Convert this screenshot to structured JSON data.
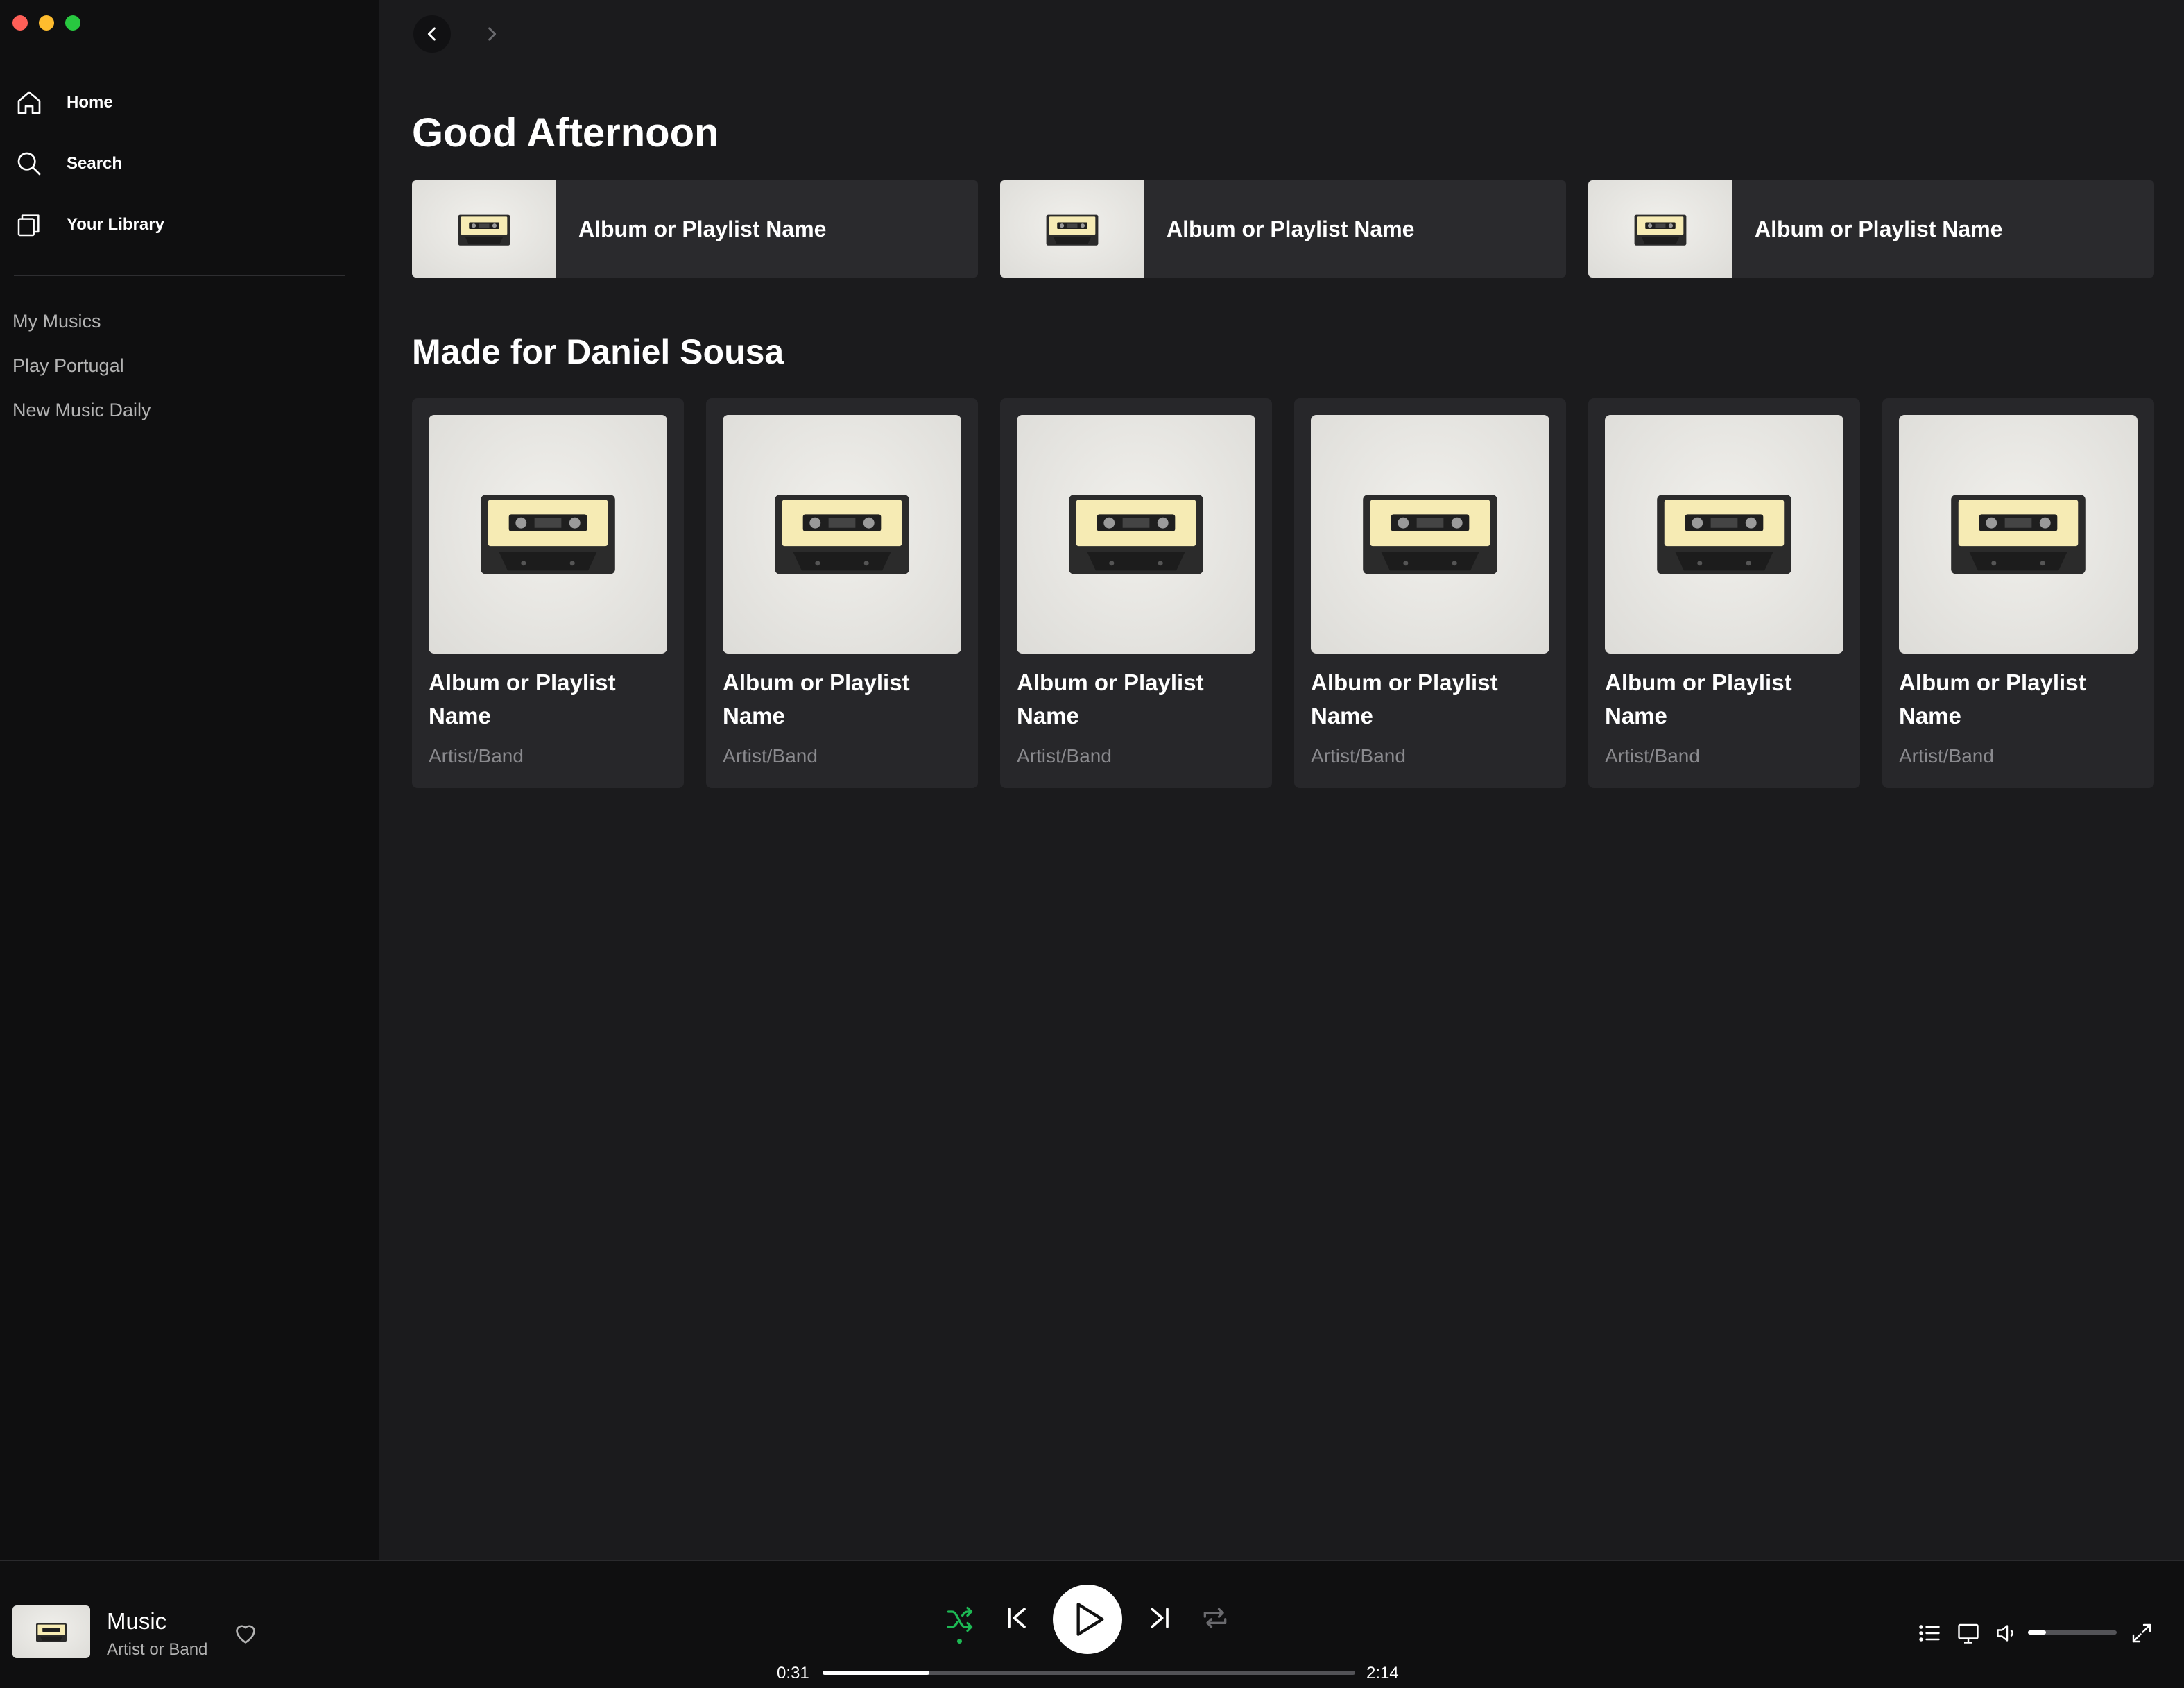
{
  "window": {
    "controls": [
      "close",
      "minimize",
      "zoom"
    ]
  },
  "sidebar": {
    "nav": [
      {
        "label": "Home",
        "icon": "home-icon"
      },
      {
        "label": "Search",
        "icon": "search-icon"
      },
      {
        "label": "Your Library",
        "icon": "library-icon"
      }
    ],
    "playlists": [
      "My Musics",
      "Play Portugal",
      "New Music Daily"
    ]
  },
  "main": {
    "greeting": "Good Afternoon",
    "quick_picks": [
      {
        "name": "Album or Playlist Name"
      },
      {
        "name": "Album or Playlist Name"
      },
      {
        "name": "Album or Playlist Name"
      }
    ],
    "made_for_title": "Made for Daniel Sousa",
    "cards": [
      {
        "title": "Album or Playlist Name",
        "subtitle": "Artist/Band"
      },
      {
        "title": "Album or Playlist Name",
        "subtitle": "Artist/Band"
      },
      {
        "title": "Album or Playlist Name",
        "subtitle": "Artist/Band"
      },
      {
        "title": "Album or Playlist Name",
        "subtitle": "Artist/Band"
      },
      {
        "title": "Album or Playlist Name",
        "subtitle": "Artist/Band"
      },
      {
        "title": "Album or Playlist Name",
        "subtitle": "Artist/Band"
      }
    ]
  },
  "player": {
    "track_title": "Music",
    "track_artist": "Artist or Band",
    "elapsed": "0:31",
    "duration": "2:14",
    "progress": 0.2,
    "volume": 0.2,
    "shuffle_active": true
  },
  "colors": {
    "accent": "#1db954",
    "sidebar_bg": "#0f0f10",
    "main_bg": "#1b1b1d",
    "card_bg": "#27272a",
    "close": "#fe5f57",
    "minimize": "#febc2e",
    "zoom": "#28c840"
  }
}
